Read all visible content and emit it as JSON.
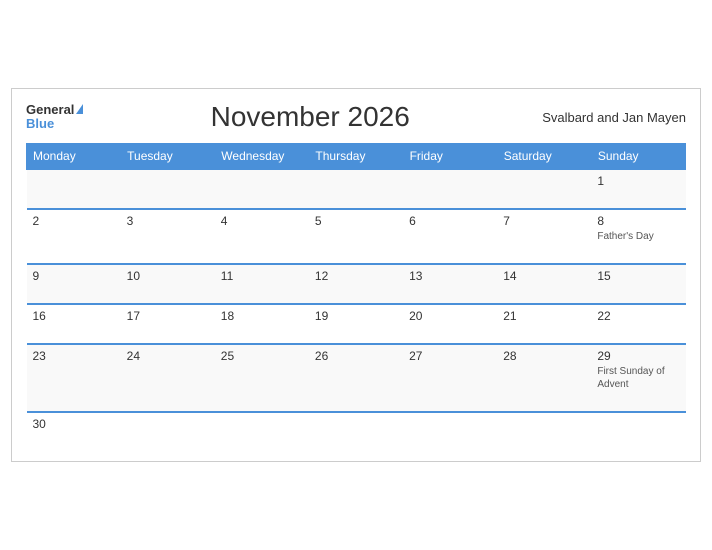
{
  "header": {
    "logo_general": "General",
    "logo_blue": "Blue",
    "title": "November 2026",
    "region": "Svalbard and Jan Mayen"
  },
  "days_of_week": [
    "Monday",
    "Tuesday",
    "Wednesday",
    "Thursday",
    "Friday",
    "Saturday",
    "Sunday"
  ],
  "weeks": [
    [
      {
        "date": "",
        "event": ""
      },
      {
        "date": "",
        "event": ""
      },
      {
        "date": "",
        "event": ""
      },
      {
        "date": "",
        "event": ""
      },
      {
        "date": "",
        "event": ""
      },
      {
        "date": "",
        "event": ""
      },
      {
        "date": "1",
        "event": ""
      }
    ],
    [
      {
        "date": "2",
        "event": ""
      },
      {
        "date": "3",
        "event": ""
      },
      {
        "date": "4",
        "event": ""
      },
      {
        "date": "5",
        "event": ""
      },
      {
        "date": "6",
        "event": ""
      },
      {
        "date": "7",
        "event": ""
      },
      {
        "date": "8",
        "event": "Father's Day"
      }
    ],
    [
      {
        "date": "9",
        "event": ""
      },
      {
        "date": "10",
        "event": ""
      },
      {
        "date": "11",
        "event": ""
      },
      {
        "date": "12",
        "event": ""
      },
      {
        "date": "13",
        "event": ""
      },
      {
        "date": "14",
        "event": ""
      },
      {
        "date": "15",
        "event": ""
      }
    ],
    [
      {
        "date": "16",
        "event": ""
      },
      {
        "date": "17",
        "event": ""
      },
      {
        "date": "18",
        "event": ""
      },
      {
        "date": "19",
        "event": ""
      },
      {
        "date": "20",
        "event": ""
      },
      {
        "date": "21",
        "event": ""
      },
      {
        "date": "22",
        "event": ""
      }
    ],
    [
      {
        "date": "23",
        "event": ""
      },
      {
        "date": "24",
        "event": ""
      },
      {
        "date": "25",
        "event": ""
      },
      {
        "date": "26",
        "event": ""
      },
      {
        "date": "27",
        "event": ""
      },
      {
        "date": "28",
        "event": ""
      },
      {
        "date": "29",
        "event": "First Sunday of Advent"
      }
    ],
    [
      {
        "date": "30",
        "event": ""
      },
      {
        "date": "",
        "event": ""
      },
      {
        "date": "",
        "event": ""
      },
      {
        "date": "",
        "event": ""
      },
      {
        "date": "",
        "event": ""
      },
      {
        "date": "",
        "event": ""
      },
      {
        "date": "",
        "event": ""
      }
    ]
  ]
}
